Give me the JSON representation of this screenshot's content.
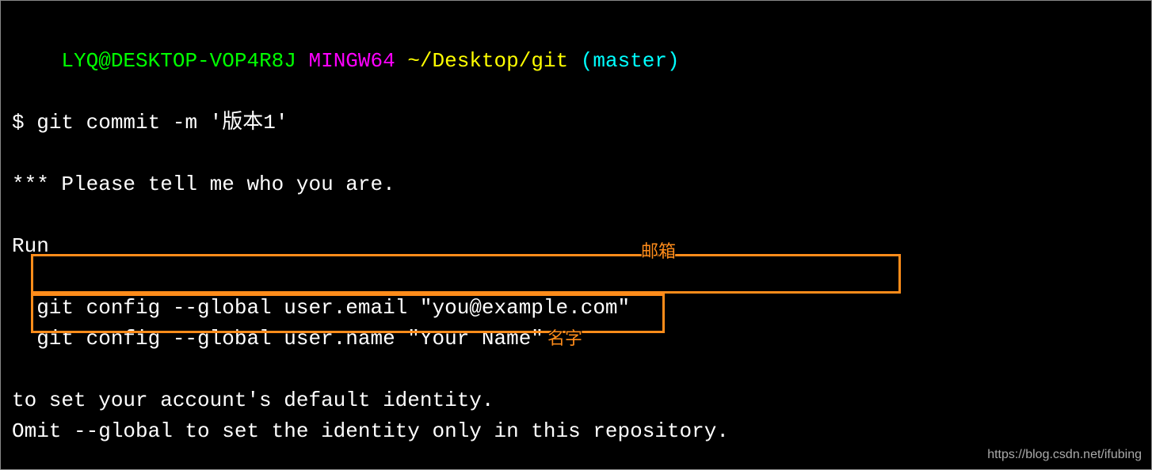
{
  "prompt": {
    "user_host": "LYQ@DESKTOP-VOP4R8J",
    "mingw": "MINGW64",
    "path": "~/Desktop/git",
    "branch": "(master)"
  },
  "command": {
    "symbol": "$",
    "text": "git commit -m '版本1'"
  },
  "output": {
    "line1": "*** Please tell me who you are.",
    "line2": "Run",
    "line3": "  git config --global user.email \"you@example.com\"",
    "line4": "  git config --global user.name \"Your Name\"",
    "line5": "to set your account's default identity.",
    "line6": "Omit --global to set the identity only in this repository."
  },
  "annotations": {
    "email": "邮箱",
    "name": "名字"
  },
  "watermark": "https://blog.csdn.net/ifubing"
}
